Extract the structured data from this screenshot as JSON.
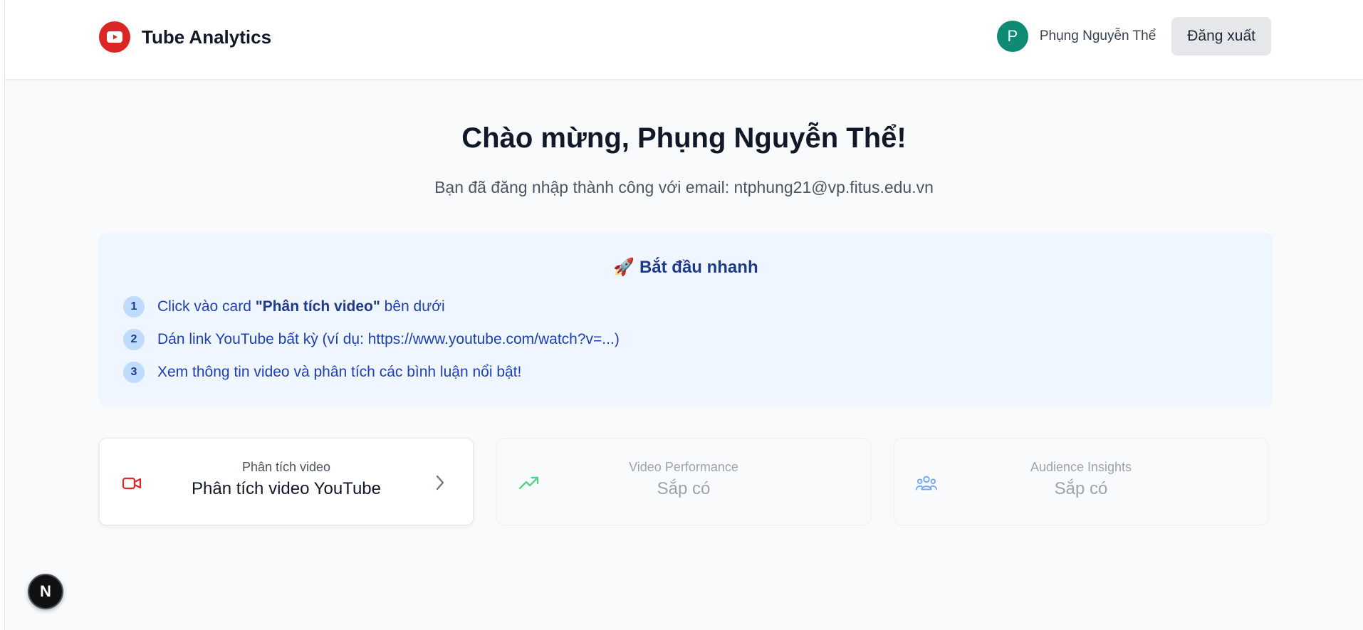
{
  "header": {
    "app_title": "Tube Analytics",
    "logo_icon": "youtube-play-icon",
    "brand_color": "#dc2626",
    "user": {
      "avatar_initial": "P",
      "avatar_color": "#0f8a73",
      "name": "Phụng Nguyễn Thể"
    },
    "logout_label": "Đăng xuất"
  },
  "welcome": {
    "title": "Chào mừng, Phụng Nguyễn Thể!",
    "subtitle": "Bạn đã đăng nhập thành công với email: ntphung21@vp.fitus.edu.vn"
  },
  "quickstart": {
    "icon": "🚀",
    "title": "Bắt đầu nhanh",
    "steps": [
      {
        "number": "1",
        "prefix": "Click vào card ",
        "bold": "\"Phân tích video\"",
        "suffix": " bên dưới"
      },
      {
        "number": "2",
        "text": "Dán link YouTube bất kỳ (ví dụ: https://www.youtube.com/watch?v=...)"
      },
      {
        "number": "3",
        "text": "Xem thông tin video và phân tích các bình luận nổi bật!"
      }
    ]
  },
  "cards": [
    {
      "label": "Phân tích video",
      "value": "Phân tích video YouTube",
      "icon": "video-camera-icon",
      "icon_color": "#dc2626",
      "enabled": true
    },
    {
      "label": "Video Performance",
      "value": "Sắp có",
      "icon": "trending-up-icon",
      "icon_color": "#22c55e",
      "enabled": false
    },
    {
      "label": "Audience Insights",
      "value": "Sắp có",
      "icon": "users-icon",
      "icon_color": "#3b82f6",
      "enabled": false
    }
  ],
  "devtools": {
    "label": "N"
  }
}
